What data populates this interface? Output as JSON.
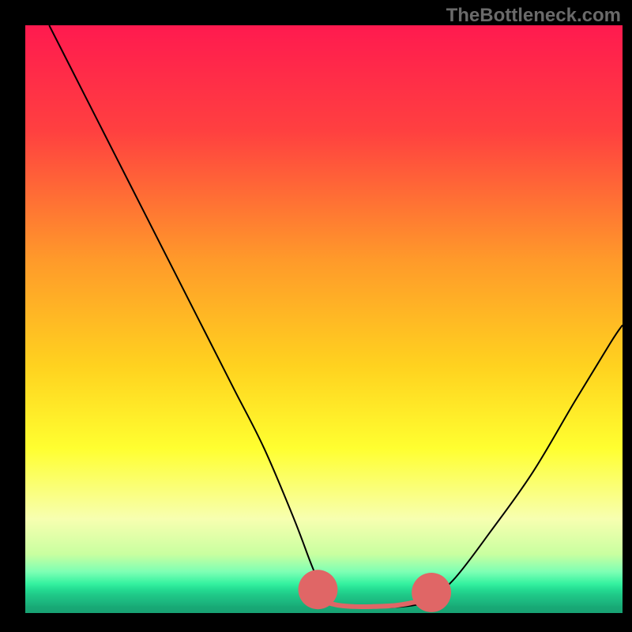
{
  "watermark": "TheBottleneck.com",
  "chart_data": {
    "type": "line",
    "title": "",
    "xlabel": "",
    "ylabel": "",
    "xlim": [
      0,
      100
    ],
    "ylim": [
      0,
      100
    ],
    "background_gradient_stops": [
      {
        "offset": 0,
        "color": "#ff1a4f"
      },
      {
        "offset": 18,
        "color": "#ff4040"
      },
      {
        "offset": 40,
        "color": "#ff9a2a"
      },
      {
        "offset": 58,
        "color": "#ffd21f"
      },
      {
        "offset": 72,
        "color": "#ffff30"
      },
      {
        "offset": 84,
        "color": "#f7ffb0"
      },
      {
        "offset": 90,
        "color": "#c9ffa0"
      },
      {
        "offset": 93,
        "color": "#7dffb4"
      },
      {
        "offset": 95,
        "color": "#35f2a0"
      },
      {
        "offset": 96,
        "color": "#24dc92"
      },
      {
        "offset": 97,
        "color": "#1fc787"
      },
      {
        "offset": 98,
        "color": "#1cb980"
      },
      {
        "offset": 99,
        "color": "#18a975"
      },
      {
        "offset": 100,
        "color": "#18a274"
      }
    ],
    "series": [
      {
        "name": "bottleneck-curve",
        "stroke": "#000000",
        "stroke_width": 2,
        "x": [
          4,
          10,
          15,
          20,
          25,
          30,
          35,
          40,
          45,
          48,
          50,
          52,
          55,
          58,
          62,
          66,
          68,
          72,
          78,
          85,
          92,
          98,
          100
        ],
        "y": [
          100,
          88,
          78,
          68,
          58,
          48,
          38,
          28,
          16,
          8,
          3.5,
          1.5,
          1,
          1,
          1,
          1.5,
          2.5,
          6,
          14,
          24,
          36,
          46,
          49
        ]
      },
      {
        "name": "bottom-highlight",
        "stroke": "#e06666",
        "stroke_width": 6,
        "x": [
          49,
          50,
          52,
          55,
          58,
          62,
          65,
          67,
          68
        ],
        "y": [
          4,
          2.2,
          1.4,
          1.1,
          1.1,
          1.3,
          1.8,
          2.2,
          3.5
        ]
      }
    ],
    "endpoint_markers": [
      {
        "name": "highlight-start",
        "x": 49,
        "y": 4,
        "r": 3.3,
        "color": "#e06666"
      },
      {
        "name": "highlight-end",
        "x": 68,
        "y": 3.5,
        "r": 3.3,
        "color": "#e06666"
      }
    ]
  }
}
